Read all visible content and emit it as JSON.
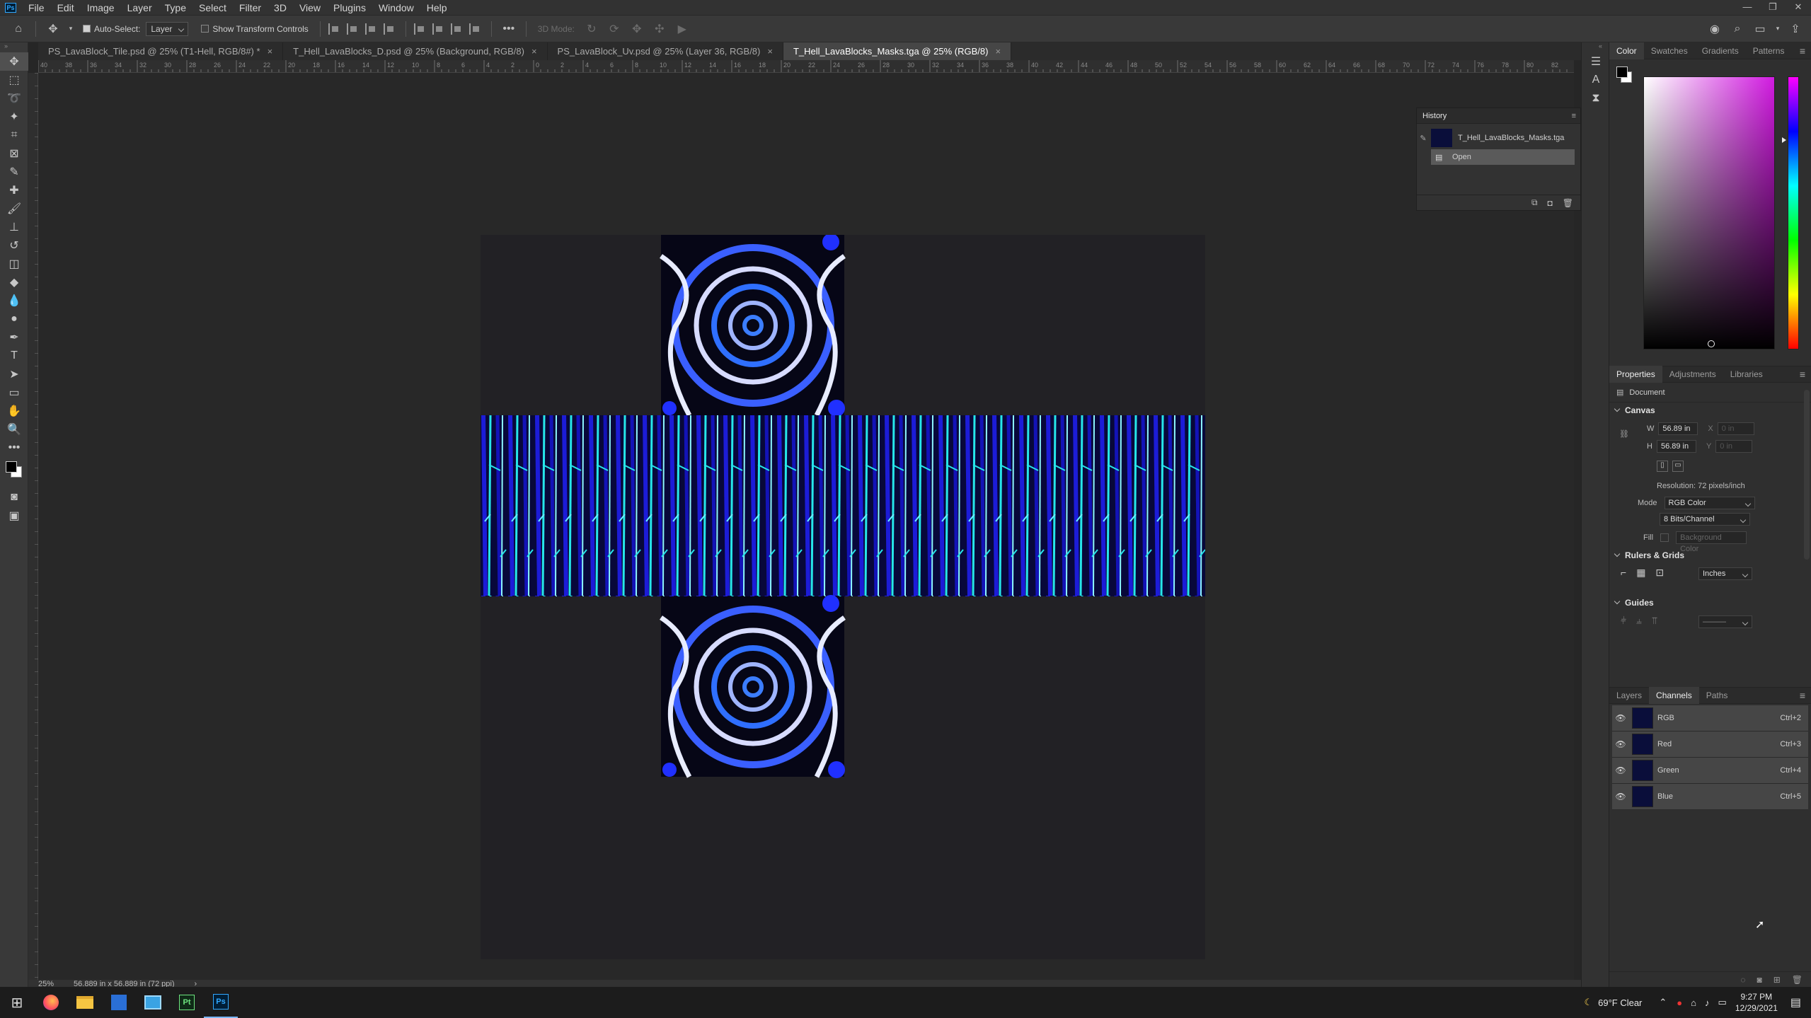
{
  "app": {
    "logo": "Ps"
  },
  "menu": [
    "File",
    "Edit",
    "Image",
    "Layer",
    "Type",
    "Select",
    "Filter",
    "3D",
    "View",
    "Plugins",
    "Window",
    "Help"
  ],
  "options": {
    "auto_select_label": "Auto-Select:",
    "auto_select_value": "Layer",
    "transform_label": "Show Transform Controls",
    "mode_3d_label": "3D Mode:"
  },
  "tabs": [
    {
      "label": "PS_LavaBlock_Tile.psd @ 25% (T1-Hell, RGB/8#) *"
    },
    {
      "label": "T_Hell_LavaBlocks_D.psd @ 25% (Background, RGB/8)"
    },
    {
      "label": "PS_LavaBlock_Uv.psd @ 25% (Layer 36, RGB/8)"
    },
    {
      "label": "T_Hell_LavaBlocks_Masks.tga @ 25% (RGB/8)"
    }
  ],
  "tab_close": "×",
  "ruler_h_labels": [
    "40",
    "38",
    "36",
    "34",
    "32",
    "30",
    "28",
    "26",
    "24",
    "22",
    "20",
    "18",
    "16",
    "14",
    "12",
    "10",
    "8",
    "6",
    "4",
    "2",
    "0",
    "2",
    "4",
    "6",
    "8",
    "10",
    "12",
    "14",
    "16",
    "18",
    "20",
    "22",
    "24",
    "26",
    "28",
    "30",
    "32",
    "34",
    "36",
    "38",
    "40",
    "42",
    "44",
    "46",
    "48",
    "50",
    "52",
    "54",
    "56",
    "58",
    "60",
    "62",
    "64",
    "66",
    "68",
    "70",
    "72",
    "74",
    "76",
    "78",
    "80",
    "82",
    "84"
  ],
  "history": {
    "title": "History",
    "snapshot_label": "T_Hell_LavaBlocks_Masks.tga",
    "open_label": "Open"
  },
  "color_panel": {
    "tabs": [
      "Color",
      "Swatches",
      "Gradients",
      "Patterns"
    ],
    "active": "Color",
    "foreground": "#000000",
    "background": "#ffffff"
  },
  "properties": {
    "tabs": [
      "Properties",
      "Adjustments",
      "Libraries"
    ],
    "active": "Properties",
    "document_label": "Document",
    "canvas_head": "Canvas",
    "w_label": "W",
    "w_value": "56.89 in",
    "h_label": "H",
    "h_value": "56.89 in",
    "x_label": "X",
    "x_value": "0 in",
    "y_label": "Y",
    "y_value": "0 in",
    "resolution": "Resolution: 72 pixels/inch",
    "mode_label": "Mode",
    "mode_value": "RGB Color",
    "depth_value": "8 Bits/Channel",
    "fill_label": "Fill",
    "fill_value": "Background Color",
    "rulers_head": "Rulers & Grids",
    "units_value": "Inches",
    "guides_head": "Guides"
  },
  "layers_panel": {
    "tabs": [
      "Layers",
      "Channels",
      "Paths"
    ],
    "active": "Channels",
    "channels": [
      {
        "name": "RGB",
        "shortcut": "Ctrl+2"
      },
      {
        "name": "Red",
        "shortcut": "Ctrl+3"
      },
      {
        "name": "Green",
        "shortcut": "Ctrl+4"
      },
      {
        "name": "Blue",
        "shortcut": "Ctrl+5"
      }
    ]
  },
  "status": {
    "zoom": "25%",
    "doc_size": "56.889 in x 56.889 in (72 ppi)",
    "arrow": "›"
  },
  "taskbar": {
    "weather": "69°F  Clear",
    "time": "9:27 PM",
    "date": "12/29/2021",
    "pt_label": "Pt",
    "ps_label": "Ps"
  },
  "colors": {
    "accent": "#31a8ff",
    "lava_blue": "#1212c8",
    "lava_cyan": "#26e0e8",
    "swirl_blue": "#2f6fff"
  }
}
